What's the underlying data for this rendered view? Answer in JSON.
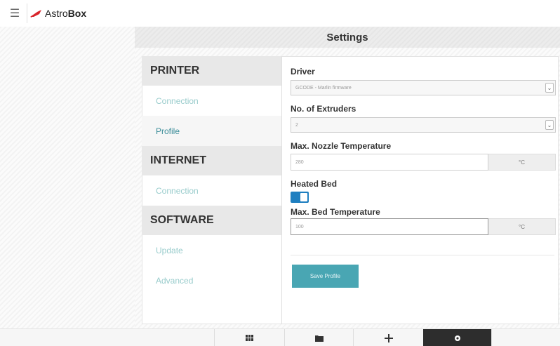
{
  "app": {
    "logo_prefix": "Astro",
    "logo_suffix": "Box"
  },
  "header": {
    "title": "Settings"
  },
  "menu": {
    "sections": [
      {
        "title": "PRINTER",
        "items": [
          "Connection",
          "Profile"
        ]
      },
      {
        "title": "INTERNET",
        "items": [
          "Connection"
        ]
      },
      {
        "title": "SOFTWARE",
        "items": [
          "Update",
          "Advanced"
        ]
      }
    ],
    "active": "Profile"
  },
  "form": {
    "driver_label": "Driver",
    "driver_value": "GCODE - Marlin firmware",
    "extruders_label": "No. of Extruders",
    "extruders_value": "2",
    "nozzle_label": "Max. Nozzle Temperature",
    "nozzle_value": "280",
    "nozzle_unit": "°C",
    "heated_bed_label": "Heated Bed",
    "heated_bed_on": true,
    "bed_label": "Max. Bed Temperature",
    "bed_value": "100",
    "bed_unit": "°C",
    "save_label": "Save Profile"
  },
  "bottombar": {
    "icons": [
      "grid-icon",
      "folder-icon",
      "move-icon",
      "gear-icon"
    ],
    "active": "gear-icon"
  },
  "colors": {
    "accent": "#49a6b3",
    "toggle": "#1f7fc0",
    "logo_red": "#d8252b"
  }
}
